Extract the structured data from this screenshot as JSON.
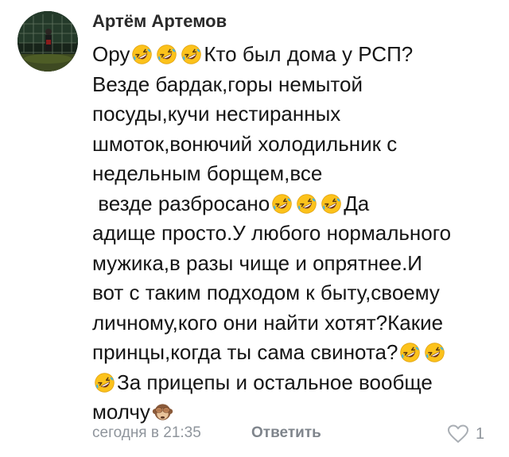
{
  "comment": {
    "author": "Артём Артемов",
    "lines": [
      [
        {
          "t": "Ору"
        },
        {
          "e": "rofl"
        },
        {
          "e": "rofl"
        },
        {
          "e": "rofl"
        },
        {
          "t": "Кто был дома у РСП?"
        }
      ],
      [
        {
          "t": "Везде бардак,горы немытой"
        }
      ],
      [
        {
          "t": "посуды,кучи нестиранных"
        }
      ],
      [
        {
          "t": "шмоток,вонючий холодильник с"
        }
      ],
      [
        {
          "t": "недельным борщем,все"
        }
      ],
      [
        {
          "t": " везде разбросано"
        },
        {
          "e": "rofl"
        },
        {
          "e": "rofl"
        },
        {
          "e": "rofl"
        },
        {
          "t": "Да"
        }
      ],
      [
        {
          "t": "адище просто.У любого нормального"
        }
      ],
      [
        {
          "t": "мужика,в разы чище и опрятнее.И"
        }
      ],
      [
        {
          "t": "вот с таким подходом к быту,своему"
        }
      ],
      [
        {
          "t": "личному,кого они найти хотят?Какие"
        }
      ],
      [
        {
          "t": "принцы,когда ты сама свинота?"
        },
        {
          "e": "rofl"
        },
        {
          "e": "rofl"
        }
      ],
      [
        {
          "e": "rofl"
        },
        {
          "t": "За прицепы и остальное вообще"
        }
      ],
      [
        {
          "t": "молчу"
        },
        {
          "e": "monkey"
        }
      ]
    ],
    "timestamp": "сегодня в 21:35",
    "reply_label": "Ответить",
    "like_count": "1",
    "icons": {
      "like": "heart-outline-icon",
      "emoji_rofl": "rolling-on-floor-laughing-emoji",
      "emoji_monkey": "see-no-evil-monkey-emoji"
    },
    "colors": {
      "meta_text": "#8f959c",
      "author_text": "#2a2a2a",
      "body_text": "#151515",
      "emoji_face": "#fcc21b",
      "emoji_tear": "#40b4e8"
    }
  }
}
